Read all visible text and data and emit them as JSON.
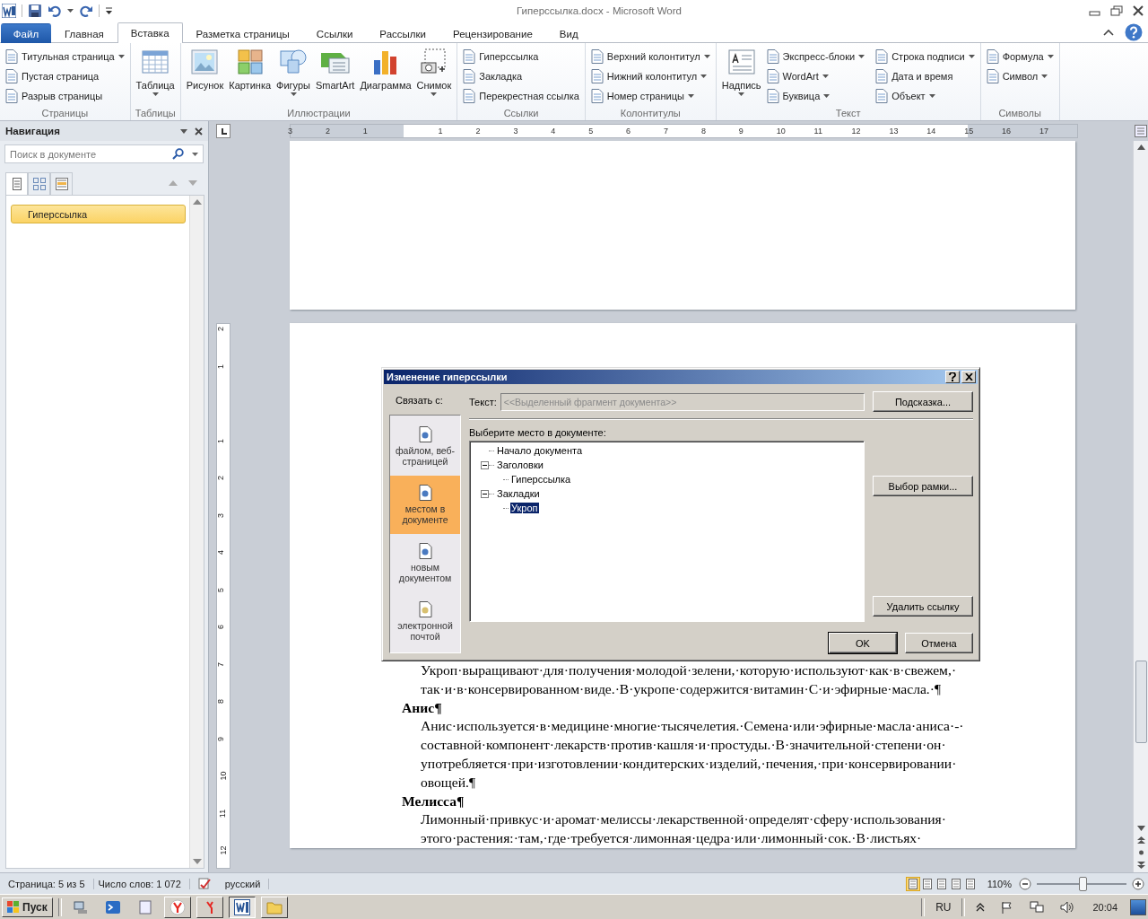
{
  "window": {
    "title": "Гиперссылка.docx - Microsoft Word"
  },
  "ribbon_tabs": [
    {
      "label": "Файл",
      "kind": "file",
      "selected": false
    },
    {
      "label": "Главная",
      "kind": "tab",
      "selected": false
    },
    {
      "label": "Вставка",
      "kind": "tab",
      "selected": true
    },
    {
      "label": "Разметка страницы",
      "kind": "tab",
      "selected": false
    },
    {
      "label": "Ссылки",
      "kind": "tab",
      "selected": false
    },
    {
      "label": "Рассылки",
      "kind": "tab",
      "selected": false
    },
    {
      "label": "Рецензирование",
      "kind": "tab",
      "selected": false
    },
    {
      "label": "Вид",
      "kind": "tab",
      "selected": false
    }
  ],
  "ribbon_groups": [
    {
      "label": "Страницы",
      "items": [
        {
          "label": "Титульная страница",
          "kind": "small",
          "dropdown": true
        },
        {
          "label": "Пустая страница",
          "kind": "small",
          "dropdown": false
        },
        {
          "label": "Разрыв страницы",
          "kind": "small",
          "dropdown": false
        }
      ]
    },
    {
      "label": "Таблицы",
      "items": [
        {
          "label": "Таблица",
          "kind": "large",
          "dropdown": true
        }
      ]
    },
    {
      "label": "Иллюстрации",
      "items": [
        {
          "label": "Рисунок",
          "kind": "large",
          "dropdown": false
        },
        {
          "label": "Картинка",
          "kind": "large",
          "dropdown": false
        },
        {
          "label": "Фигуры",
          "kind": "large",
          "dropdown": true
        },
        {
          "label": "SmartArt",
          "kind": "large",
          "dropdown": false
        },
        {
          "label": "Диаграмма",
          "kind": "large",
          "dropdown": false
        },
        {
          "label": "Снимок",
          "kind": "large",
          "dropdown": true
        }
      ]
    },
    {
      "label": "Ссылки",
      "items": [
        {
          "label": "Гиперссылка",
          "kind": "small",
          "dropdown": false
        },
        {
          "label": "Закладка",
          "kind": "small",
          "dropdown": false
        },
        {
          "label": "Перекрестная ссылка",
          "kind": "small",
          "dropdown": false
        }
      ]
    },
    {
      "label": "Колонтитулы",
      "items": [
        {
          "label": "Верхний колонтитул",
          "kind": "small",
          "dropdown": true
        },
        {
          "label": "Нижний колонтитул",
          "kind": "small",
          "dropdown": true
        },
        {
          "label": "Номер страницы",
          "kind": "small",
          "dropdown": true
        }
      ]
    },
    {
      "label": "Текст",
      "items": [
        {
          "label": "Надпись",
          "kind": "large",
          "dropdown": true
        },
        {
          "label": "Экспресс-блоки",
          "kind": "small",
          "dropdown": true
        },
        {
          "label": "WordArt",
          "kind": "small",
          "dropdown": true
        },
        {
          "label": "Буквица",
          "kind": "small",
          "dropdown": true
        },
        {
          "label": "Строка подписи",
          "kind": "small",
          "dropdown": true
        },
        {
          "label": "Дата и время",
          "kind": "small",
          "dropdown": false
        },
        {
          "label": "Объект",
          "kind": "small",
          "dropdown": true
        }
      ]
    },
    {
      "label": "Символы",
      "items": [
        {
          "label": "Формула",
          "kind": "small",
          "dropdown": true
        },
        {
          "label": "Символ",
          "kind": "small",
          "dropdown": true
        }
      ]
    }
  ],
  "navigation": {
    "title": "Навигация",
    "search": {
      "placeholder": "Поиск в документе"
    },
    "views": [
      {
        "selected": true
      },
      {
        "selected": false
      },
      {
        "selected": false
      }
    ],
    "headings": [
      {
        "label": "Гиперссылка",
        "selected": true
      }
    ]
  },
  "ruler": {
    "marks": [
      "3",
      "2",
      "1",
      "1",
      "2",
      "3",
      "4",
      "5",
      "6",
      "7",
      "8",
      "9",
      "10",
      "11",
      "12",
      "13",
      "14",
      "15",
      "16",
      "17"
    ],
    "vertical_marks": [
      "2",
      "1",
      "1",
      "2",
      "3",
      "4",
      "5",
      "6",
      "7",
      "8",
      "9",
      "10",
      "11",
      "12"
    ]
  },
  "document": {
    "paragraphs": [
      {
        "kind": "body",
        "text": "Укроп·выращивают·для·получения·молодой·зелени,·которую·используют·как·в·свежем,·так·и·в·консервированном·виде.·В·укропе·содержится·витамин·С·и·эфирные·масла.·¶"
      },
      {
        "kind": "heading",
        "text": "Анис¶"
      },
      {
        "kind": "body",
        "text": "Анис·используется·в·медицине·многие·тысячелетия.·Семена·или·эфирные·масла·аниса·-·составной·компонент·лекарств·против·кашля·и·простуды.·В·значительной·степени·он·употребляется·при·изготовлении·кондитерских·изделий,·печения,·при·консервировании·овощей.¶"
      },
      {
        "kind": "heading",
        "text": "Мелисса¶"
      },
      {
        "kind": "body",
        "text": "Лимонный·привкус·и·аромат·мелиссы·лекарственной·определят·сферу·использования·этого·растения:·там,·где·требуется·лимонная·цедра·или·лимонный·сок.·В·листьях·"
      }
    ]
  },
  "dialog": {
    "title": "Изменение гиперссылки",
    "link_label": "Связать с:",
    "link_options": [
      {
        "label": "файлом, веб-страницей",
        "selected": false
      },
      {
        "label": "местом в документе",
        "selected": true
      },
      {
        "label": "новым документом",
        "selected": false
      },
      {
        "label": "электронной почтой",
        "selected": false
      }
    ],
    "text_label": "Текст:",
    "text_value": "<<Выделенный фрагмент документа>>",
    "text_disabled": true,
    "tree_label": "Выберите место в документе:",
    "tree": [
      {
        "label": "Начало документа",
        "selected": false
      },
      {
        "label": "Заголовки",
        "selected": false,
        "expanded": true,
        "children": [
          {
            "label": "Гиперссылка",
            "selected": false
          }
        ]
      },
      {
        "label": "Закладки",
        "selected": false,
        "expanded": true,
        "children": [
          {
            "label": "Укроп",
            "selected": true
          }
        ]
      }
    ],
    "side_buttons": [
      "Подсказка...",
      "Выбор рамки...",
      "Удалить ссылку"
    ],
    "ok": "OK",
    "cancel": "Отмена"
  },
  "status_bar": {
    "items": [
      "Страница: 5 из 5",
      "Число слов: 1 072"
    ],
    "language": "русский",
    "zoom": "110%",
    "zoom_slider": {
      "level": 0.5
    }
  },
  "taskbar": {
    "start": "Пуск",
    "language": "RU",
    "time": "20:04"
  }
}
